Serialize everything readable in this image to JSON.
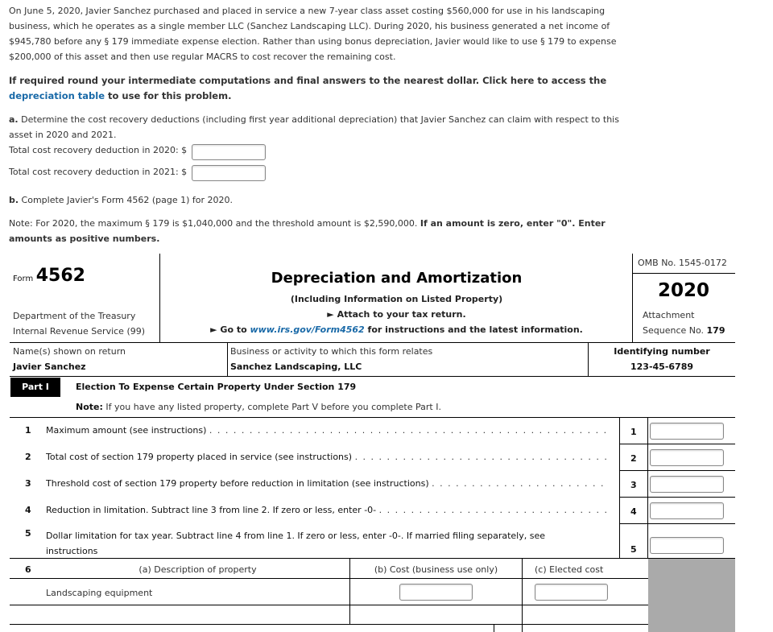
{
  "intro": {
    "lines": [
      "On June 5, 2020, Javier Sanchez purchased and placed in service a new 7-year class asset costing $560,000 for use in his landscaping",
      "business, which he operates as a single member LLC (Sanchez Landscaping LLC). During 2020, his business generated a net income of",
      "$945,780 before any § 179 immediate expense election. Rather than using bonus depreciation, Javier would like to use § 179 to expense",
      "$200,000 of this asset and then use regular MACRS to cost recover the remaining cost."
    ],
    "rounding_line1": "If required round your intermediate computations and final answers to the nearest dollar. Click here to access the",
    "rounding_link": "depreciation table",
    "rounding_line2_rest": " to use for this problem."
  },
  "part_a": {
    "prefix": "a.",
    "line1": " Determine the cost recovery deductions (including first year additional depreciation) that Javier Sanchez can claim with respect to this",
    "line2": "asset in 2020 and 2021.",
    "fields": [
      {
        "label": "Total cost recovery deduction in 2020: $",
        "value": ""
      },
      {
        "label": "Total cost recovery deduction in 2021: $",
        "value": ""
      }
    ]
  },
  "part_b": {
    "prefix": "b.",
    "text": " Complete Javier's Form 4562 (page 1) for 2020."
  },
  "note": {
    "normal": "Note: For 2020, the maximum § 179 is $1,040,000 and the threshold amount is $2,590,000. ",
    "bold1": "If an amount is zero, enter \"0\". Enter",
    "bold2": "amounts as positive numbers."
  },
  "form": {
    "form_label": "Form",
    "form_number": "4562",
    "dept1": "Department of the Treasury",
    "dept2": "Internal Revenue Service (99)",
    "title": "Depreciation and Amortization",
    "subtitle": "(Including Information on Listed Property)",
    "attach": "► Attach to your tax return.",
    "goto_prefix": "► Go to ",
    "goto_link": "www.irs.gov/Form4562",
    "goto_suffix": " for instructions and the latest information.",
    "omb": "OMB No. 1545-0172",
    "year": "2020",
    "attachment": "Attachment",
    "sequence_label": "Sequence No. ",
    "sequence_no": "179",
    "names_label": "Name(s) shown on return",
    "names_value": "Javier Sanchez",
    "business_label": "Business or activity to which this form relates",
    "business_value": "Sanchez Landscaping, LLC",
    "id_label": "Identifying number",
    "id_value": "123-45-6789",
    "part_label": "Part I",
    "part_title": "Election To Expense Certain Property Under Section 179",
    "part_note_bold": "Note:",
    "part_note": " If you have any listed property, complete Part V before you complete Part I.",
    "lines": [
      {
        "num": "1",
        "text": "Maximum amount (see instructions)",
        "dots": ". . . . . . . . . . . . . . . . . . . . . . . . . . . . . . . . . . . . . . . . . . . . . . . . . . . . . . . .",
        "value": ""
      },
      {
        "num": "2",
        "text": "Total cost of section 179 property placed in service (see instructions)",
        "dots": ". . . . . . . . . . . . . . . . . . . . . . . . . . . . . . . . . . . . . . . .",
        "value": ""
      },
      {
        "num": "3",
        "text": "Threshold cost of section 179 property before reduction in limitation (see instructions)",
        "dots": ". . . . . . . . . . . . . . . . . . . . . . . . . . .",
        "value": ""
      },
      {
        "num": "4",
        "text": "Reduction in limitation. Subtract line 3 from line 2. If zero or less, enter -0-",
        "dots": ". . . . . . . . . . . . . . . . . . . . . . . . . . . . . . . .",
        "value": ""
      },
      {
        "num": "5",
        "text": "Dollar limitation for tax year. Subtract line 4 from line 1. If zero or less, enter -0-. If married filing separately, see",
        "text2": "instructions",
        "value": ""
      }
    ],
    "line6": {
      "num": "6",
      "col_a": "(a) Description of property",
      "col_b": "(b) Cost (business use only)",
      "col_c": "(c) Elected cost",
      "rows": [
        {
          "description": "Landscaping equipment",
          "cost": "",
          "elected": ""
        }
      ]
    }
  }
}
